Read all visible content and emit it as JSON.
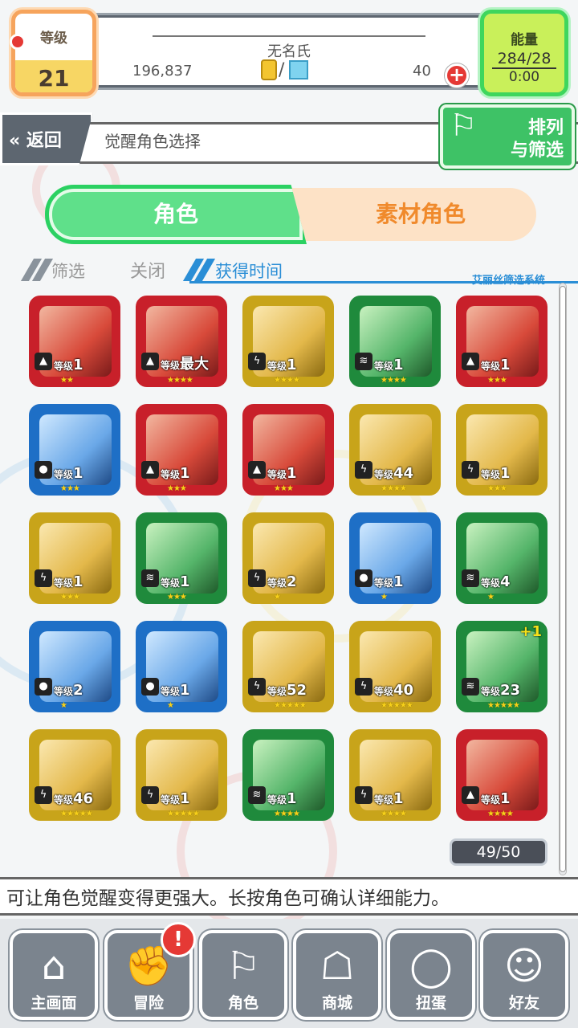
{
  "player": {
    "level_label": "等级",
    "level": "21",
    "name": "无名氏",
    "coins": "196,837",
    "separator": "/",
    "gems": "40",
    "energy_label": "能量",
    "energy": "284/28",
    "energy_timer": "0:00"
  },
  "header": {
    "back_label": "返回",
    "back_icon": "«",
    "title": "觉醒角色选择",
    "sort_label_1": "排列",
    "sort_label_2": "与筛选"
  },
  "tabs": {
    "active": "角色",
    "inactive": "素材角色"
  },
  "filter": {
    "label": "筛选",
    "state": "关闭",
    "sort": "获得时间",
    "system": "艾丽丝筛选系统"
  },
  "level_prefix": "等级",
  "cards": [
    {
      "frame": "red",
      "elem": "fire",
      "level": "1",
      "stars": "★★"
    },
    {
      "frame": "red",
      "elem": "fire",
      "level": "最大",
      "stars": "★★★★"
    },
    {
      "frame": "gold",
      "elem": "bolt",
      "level": "1",
      "stars": "★★★★"
    },
    {
      "frame": "green",
      "elem": "wind",
      "level": "1",
      "stars": "★★★★"
    },
    {
      "frame": "red",
      "elem": "fire",
      "level": "1",
      "stars": "★★★"
    },
    {
      "frame": "blue",
      "elem": "water",
      "level": "1",
      "stars": "★★★"
    },
    {
      "frame": "red",
      "elem": "fire",
      "level": "1",
      "stars": "★★★"
    },
    {
      "frame": "red",
      "elem": "fire",
      "level": "1",
      "stars": "★★★"
    },
    {
      "frame": "gold",
      "elem": "bolt",
      "level": "44",
      "stars": "★★★★"
    },
    {
      "frame": "gold",
      "elem": "bolt",
      "level": "1",
      "stars": "★★★"
    },
    {
      "frame": "gold",
      "elem": "bolt",
      "level": "1",
      "stars": "★★★"
    },
    {
      "frame": "green",
      "elem": "wind",
      "level": "1",
      "stars": "★★★"
    },
    {
      "frame": "gold",
      "elem": "bolt",
      "level": "2",
      "stars": "★"
    },
    {
      "frame": "blue",
      "elem": "water",
      "level": "1",
      "stars": "★"
    },
    {
      "frame": "green",
      "elem": "wind",
      "level": "4",
      "stars": "★"
    },
    {
      "frame": "blue",
      "elem": "water",
      "level": "2",
      "stars": "★"
    },
    {
      "frame": "blue",
      "elem": "water",
      "level": "1",
      "stars": "★"
    },
    {
      "frame": "gold",
      "elem": "bolt",
      "level": "52",
      "stars": "★★★★★"
    },
    {
      "frame": "gold",
      "elem": "bolt",
      "level": "40",
      "stars": "★★★★★"
    },
    {
      "frame": "green",
      "elem": "wind",
      "level": "23",
      "stars": "★★★★★",
      "plus": "+1"
    },
    {
      "frame": "gold",
      "elem": "bolt",
      "level": "46",
      "stars": "★★★★★"
    },
    {
      "frame": "gold",
      "elem": "bolt",
      "level": "1",
      "stars": "★★★★★"
    },
    {
      "frame": "green",
      "elem": "wind",
      "level": "1",
      "stars": "★★★★"
    },
    {
      "frame": "gold",
      "elem": "bolt",
      "level": "1",
      "stars": "★★★★"
    },
    {
      "frame": "red",
      "elem": "fire",
      "level": "1",
      "stars": "★★★★"
    }
  ],
  "counter": "49/50",
  "description": "可让角色觉醒变得更强大。长按角色可确认详细能力。",
  "nav": [
    {
      "label": "主画面",
      "icon": "home-icon"
    },
    {
      "label": "冒险",
      "icon": "handshake-icon"
    },
    {
      "label": "角色",
      "icon": "rabbit-icon"
    },
    {
      "label": "商城",
      "icon": "cart-icon"
    },
    {
      "label": "扭蛋",
      "icon": "egg-icon"
    },
    {
      "label": "好友",
      "icon": "friends-icon"
    }
  ],
  "nav_badge": "!",
  "colors": {
    "red": "#c8202a",
    "gold": "#c8a41a",
    "green": "#1f8a3c",
    "blue": "#1e6fc6",
    "accent_green": "#3ec266",
    "accent_orange": "#f08a2c",
    "accent_blue": "#2a8ed6"
  }
}
